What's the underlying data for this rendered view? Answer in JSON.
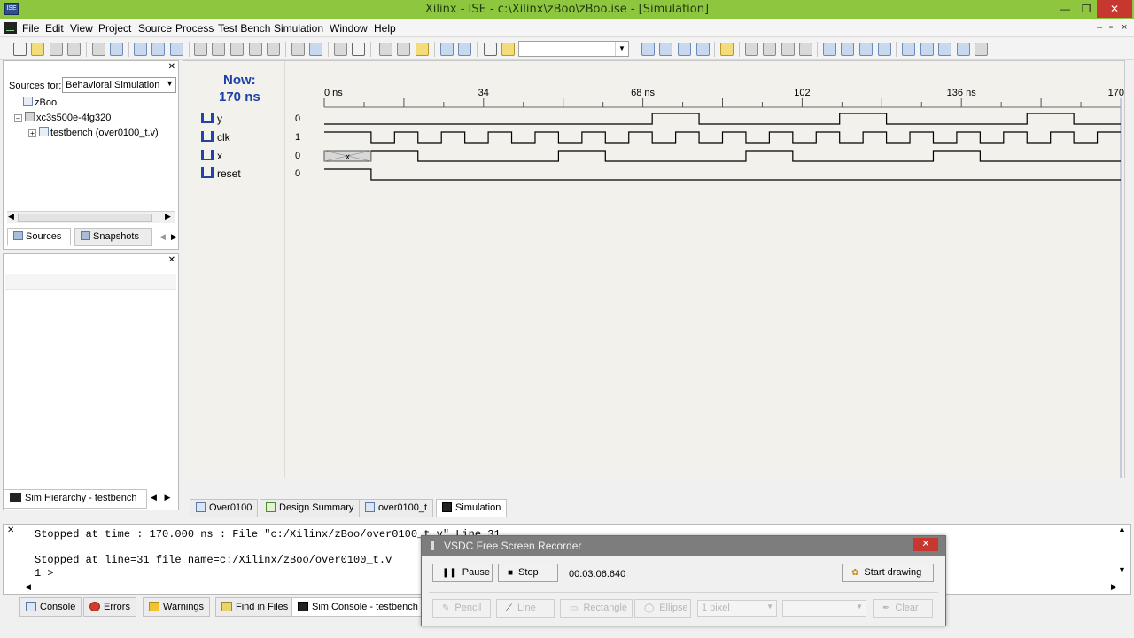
{
  "window": {
    "title": "Xilinx - ISE - c:\\Xilinx\\zBoo\\zBoo.ise - [Simulation]",
    "app_icon": "ISE",
    "controls": [
      "minimize",
      "restore",
      "close"
    ]
  },
  "menubar": {
    "items": [
      "File",
      "Edit",
      "View",
      "Project",
      "Source",
      "Process",
      "Test Bench",
      "Simulation",
      "Window",
      "Help"
    ]
  },
  "toolbar": {
    "combo_value": ""
  },
  "sources_panel": {
    "label": "Sources for:",
    "selected": "Behavioral Simulation",
    "tree": [
      {
        "label": "zBoo",
        "icon": "project-icon"
      },
      {
        "label": "xc3s500e-4fg320",
        "icon": "chip-icon"
      },
      {
        "label": "testbench (over0100_t.v)",
        "icon": "verilog-file-icon"
      }
    ],
    "tabs": [
      {
        "label": "Sources",
        "icon": "sources-icon"
      },
      {
        "label": "Snapshots",
        "icon": "snapshots-icon"
      }
    ]
  },
  "sim_hierarchy_tab": {
    "label": "Sim Hierarchy - testbench"
  },
  "waveform": {
    "now_label": "Now:",
    "now_value": "170 ns",
    "time_labels": [
      "0 ns",
      "34",
      "68 ns",
      "102",
      "136 ns",
      "170"
    ],
    "time_range_ns": [
      0,
      170
    ],
    "signals": [
      {
        "name": "y",
        "value": "0"
      },
      {
        "name": "clk",
        "value": "1"
      },
      {
        "name": "x",
        "value": "0"
      },
      {
        "name": "reset",
        "value": "0"
      }
    ],
    "x_undefined_marker": "x"
  },
  "editor_tabs": [
    {
      "label": "Over0100",
      "icon": "verilog-file-icon"
    },
    {
      "label": "Design Summary",
      "icon": "design-summary-icon"
    },
    {
      "label": "over0100_t",
      "icon": "verilog-file-icon"
    },
    {
      "label": "Simulation",
      "icon": "simulation-icon",
      "active": true
    }
  ],
  "console": {
    "lines": [
      "Stopped at time : 170.000 ns : File \"c:/Xilinx/zBoo/over0100_t.v\" Line 31",
      "Stopped at line=31 file name=c:/Xilinx/zBoo/over0100_t.v",
      "1 >"
    ]
  },
  "bottom_tabs": [
    {
      "label": "Console",
      "icon": "console-icon"
    },
    {
      "label": "Errors",
      "icon": "error-icon"
    },
    {
      "label": "Warnings",
      "icon": "warning-icon"
    },
    {
      "label": "Find in Files",
      "icon": "find-icon"
    },
    {
      "label": "Sim Console - testbench",
      "icon": "sim-console-icon",
      "active": true
    }
  ],
  "recorder": {
    "title": "VSDC Free Screen Recorder",
    "pause_label": "Pause",
    "stop_label": "Stop",
    "elapsed": "00:03:06.640",
    "start_drawing_label": "Start drawing",
    "tools": [
      "Pencil",
      "Line",
      "Rectangle",
      "Ellipse"
    ],
    "line_width": "1 pixel",
    "clear_label": "Clear"
  },
  "colors": {
    "title_bar": "#8ec63f",
    "wave_background": "#f2f1ec",
    "now_text": "#1c3fa8",
    "signal_line": "#000000"
  }
}
